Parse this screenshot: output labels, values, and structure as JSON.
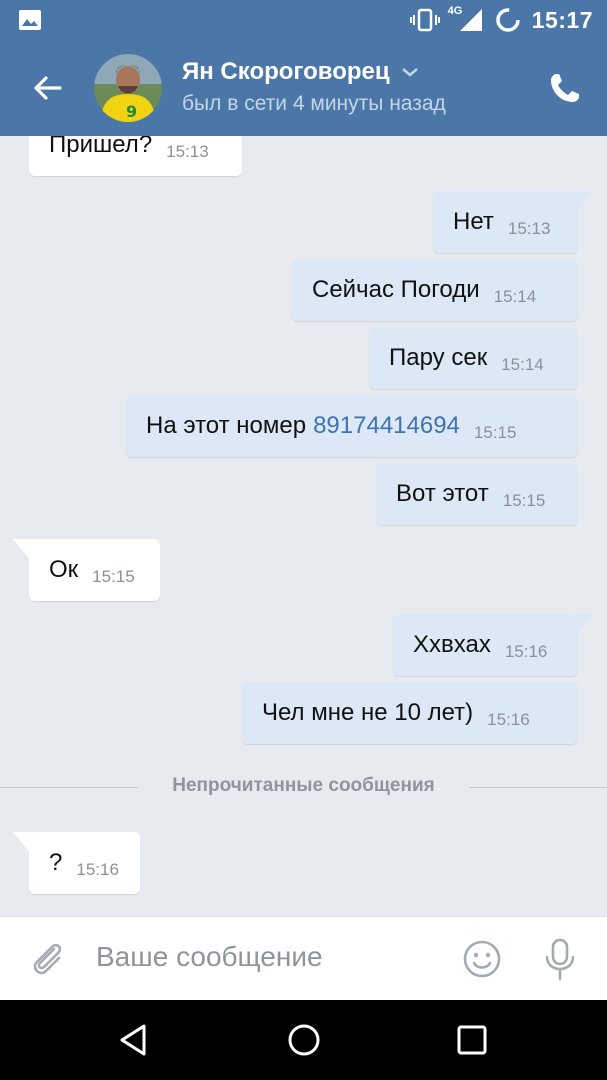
{
  "statusbar": {
    "network": "4G",
    "time": "15:17"
  },
  "header": {
    "contact_name": "Ян Скороговорец",
    "last_seen": "был в сети 4 минуты назад"
  },
  "messages": [
    {
      "dir": "in",
      "text": "Пришел?",
      "time": "15:13"
    },
    {
      "dir": "out",
      "text": "Нет",
      "time": "15:13"
    },
    {
      "dir": "out",
      "text": "Сейчас Погоди",
      "time": "15:14"
    },
    {
      "dir": "out",
      "text": "Пару сек",
      "time": "15:14"
    },
    {
      "dir": "out",
      "text": "На этот номер",
      "link": "89174414694",
      "time": "15:15"
    },
    {
      "dir": "out",
      "text": "Вот этот",
      "time": "15:15"
    },
    {
      "dir": "in",
      "text": "Ок",
      "time": "15:15"
    },
    {
      "dir": "out",
      "text": "Ххвхах",
      "time": "15:16"
    },
    {
      "dir": "out",
      "text": "Чел мне не 10 лет)",
      "time": "15:16"
    },
    {
      "dir": "in",
      "text": "?",
      "time": "15:16"
    }
  ],
  "unread_divider": "Непрочитанные сообщения",
  "composer": {
    "placeholder": "Ваше сообщение"
  },
  "colors": {
    "accent": "#4a76a8",
    "outgoing_bubble": "#dce8f6",
    "incoming_bubble": "#ffffff",
    "link": "#3f72b1"
  }
}
